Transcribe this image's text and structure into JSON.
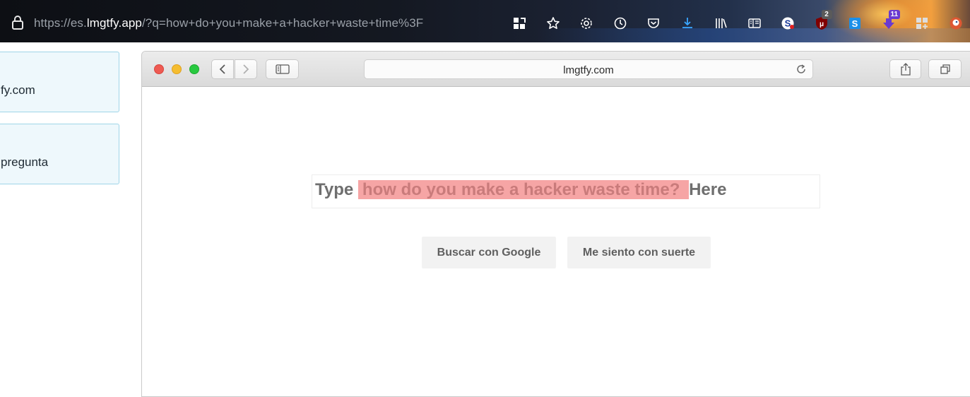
{
  "browser": {
    "url_prefix": "https://es.",
    "url_host": "lmgtfy.app",
    "url_path": "/?q=how+do+you+make+a+hacker+waste+time%3F",
    "toolbar_icons": [
      {
        "name": "extensions-grid-icon"
      },
      {
        "name": "bookmark-star-icon"
      },
      {
        "name": "settings-gear-icon"
      },
      {
        "name": "history-clock-icon"
      },
      {
        "name": "pocket-icon"
      },
      {
        "name": "downloads-icon"
      },
      {
        "name": "library-icon"
      },
      {
        "name": "reader-view-icon"
      },
      {
        "name": "s-extension-icon"
      },
      {
        "name": "ublock-icon",
        "badge": "2",
        "badge_color": "#5a5a5a"
      },
      {
        "name": "skype-icon"
      },
      {
        "name": "download-arrow-extension-icon",
        "badge": "11",
        "badge_color": "#6a3ad0"
      },
      {
        "name": "apps-plus-icon"
      },
      {
        "name": "duckduckgo-icon"
      },
      {
        "name": "monkey-icon"
      }
    ]
  },
  "left_panel": {
    "cards": [
      {
        "text": "fy.com"
      },
      {
        "text": " pregunta"
      }
    ]
  },
  "safari": {
    "address": "lmgtfy.com",
    "traffic_lights": [
      "#ee5a52",
      "#f5bd30",
      "#28c940"
    ]
  },
  "page": {
    "type_prefix": "Type",
    "query": "how do you make a hacker waste time? ",
    "type_suffix": "Here",
    "button_search": "Buscar con Google",
    "button_lucky": "Me siento con suerte"
  }
}
